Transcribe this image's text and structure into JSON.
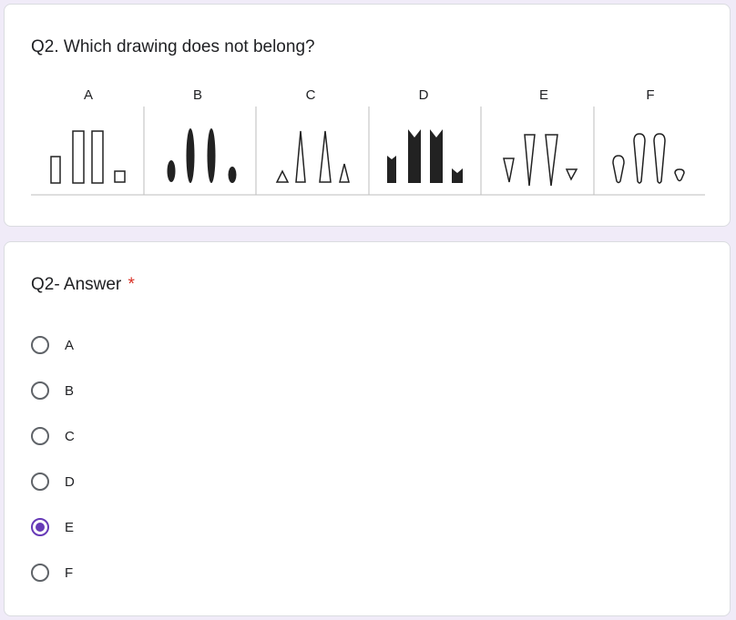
{
  "question1": {
    "title": "Q2. Which drawing does not belong?",
    "column_labels": [
      "A",
      "B",
      "C",
      "D",
      "E",
      "F"
    ]
  },
  "question2": {
    "title": "Q2- Answer",
    "required_marker": "*",
    "options": [
      {
        "label": "A",
        "selected": false
      },
      {
        "label": "B",
        "selected": false
      },
      {
        "label": "C",
        "selected": false
      },
      {
        "label": "D",
        "selected": false
      },
      {
        "label": "E",
        "selected": true
      },
      {
        "label": "F",
        "selected": false
      }
    ]
  },
  "colors": {
    "page_background": "#f0ebf8",
    "accent": "#673ab7",
    "required": "#d93025"
  }
}
